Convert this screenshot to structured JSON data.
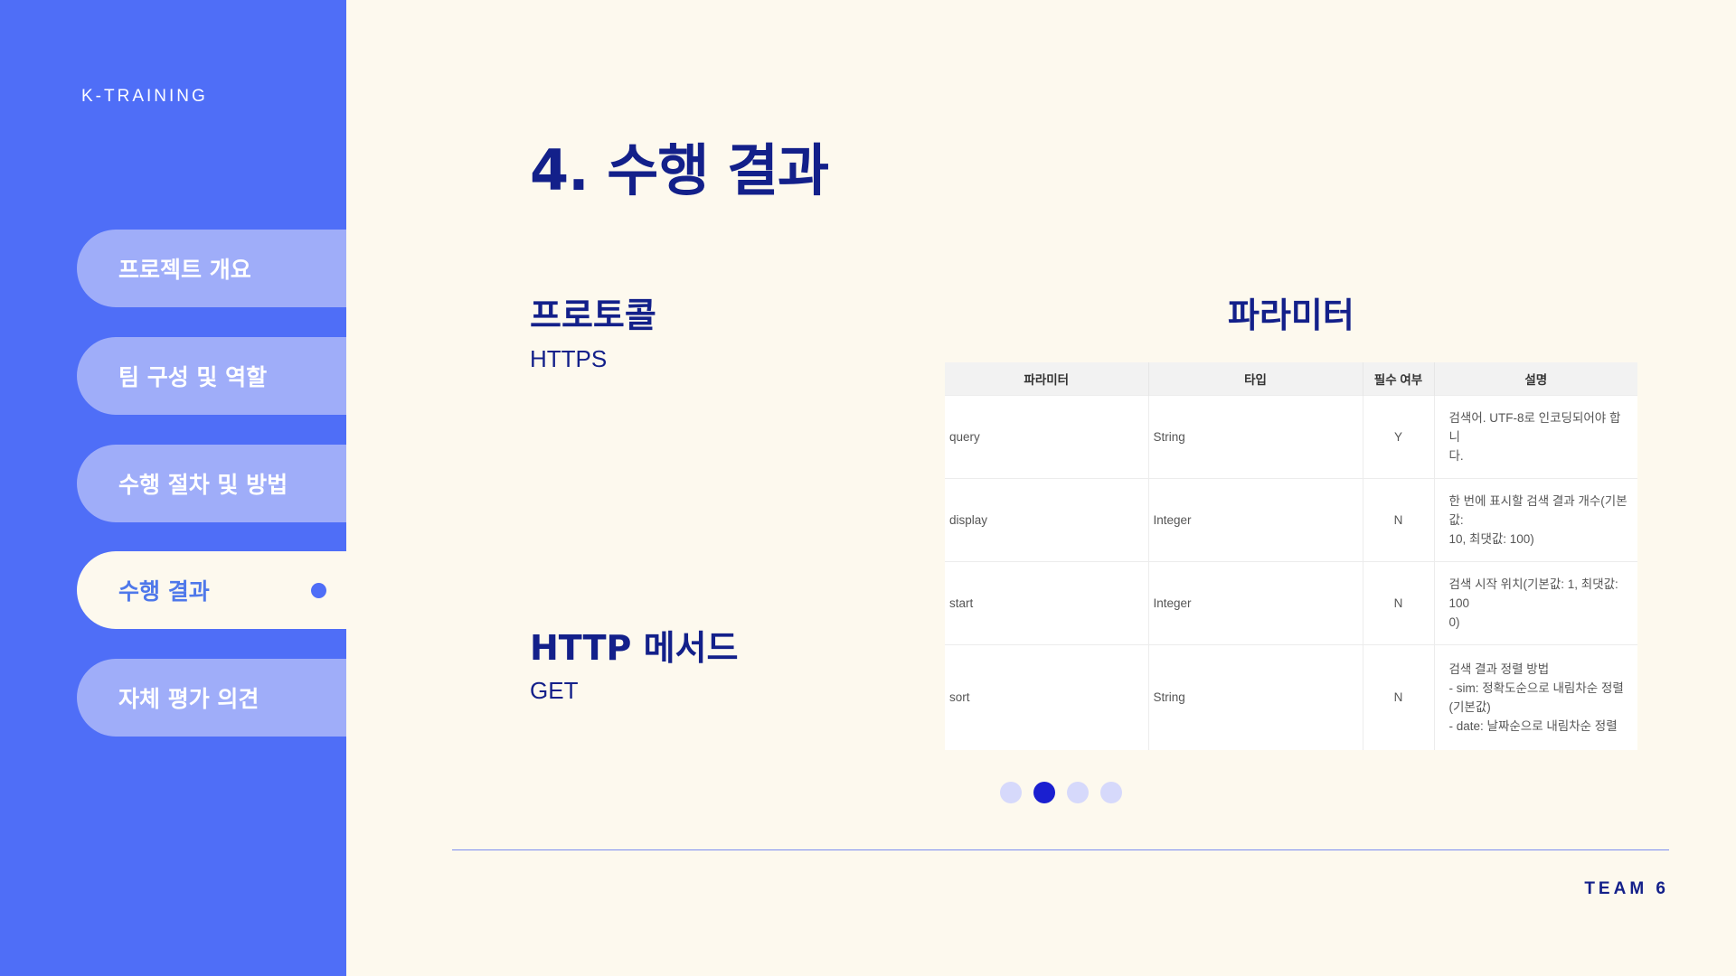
{
  "brand": "K-TRAINING",
  "nav": {
    "items": [
      {
        "label": "프로젝트 개요"
      },
      {
        "label": "팀 구성 및 역할"
      },
      {
        "label": "수행 절차 및 방법"
      },
      {
        "label": "수행 결과"
      },
      {
        "label": "자체 평가 의견"
      }
    ],
    "active_index": 3
  },
  "page_title": "4. 수행 결과",
  "protocol": {
    "heading": "프로토콜",
    "value": "HTTPS"
  },
  "method": {
    "heading": "HTTP 메서드",
    "value": "GET"
  },
  "params": {
    "heading": "파라미터",
    "columns": [
      "파라미터",
      "타입",
      "필수 여부",
      "설명"
    ],
    "rows": [
      {
        "name": "query",
        "type": "String",
        "required": "Y",
        "desc": [
          "검색어. UTF-8로 인코딩되어야 합니",
          "다."
        ]
      },
      {
        "name": "display",
        "type": "Integer",
        "required": "N",
        "desc": [
          "한 번에 표시할 검색 결과 개수(기본값:",
          "10, 최댓값: 100)"
        ]
      },
      {
        "name": "start",
        "type": "Integer",
        "required": "N",
        "desc": [
          "검색 시작 위치(기본값: 1, 최댓값: 100",
          "0)"
        ]
      },
      {
        "name": "sort",
        "type": "String",
        "required": "N",
        "desc": [
          "검색 결과 정렬 방법",
          "- sim: 정확도순으로 내림차순 정렬",
          "(기본값)",
          "- date: 날짜순으로 내림차순 정렬"
        ]
      }
    ]
  },
  "pager": {
    "count": 4,
    "current": 2
  },
  "footer": "TEAM 6",
  "colors": {
    "sidebar": "#4f6ef7",
    "background": "#fdf9ee",
    "navy": "#13208a",
    "nav_pill": "#9fadf9"
  }
}
